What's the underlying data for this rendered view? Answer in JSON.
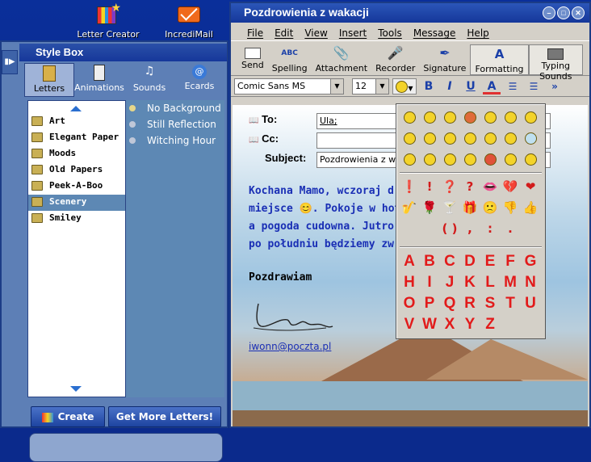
{
  "desktop": {
    "icons": [
      {
        "label": "Letter Creator"
      },
      {
        "label": "IncrediMail"
      }
    ]
  },
  "stylebox": {
    "title": "Style Box",
    "tabs": [
      "Letters",
      "Animations",
      "Sounds",
      "Ecards"
    ],
    "categories": [
      "Art",
      "Elegant Paper",
      "Moods",
      "Old Papers",
      "Peek-A-Boo",
      "Scenery",
      "Smiley"
    ],
    "selected_category": "Scenery",
    "subitems": [
      "No Background",
      "Still Reflection",
      "Witching Hour"
    ],
    "create_label": "Create",
    "more_label": "Get More Letters!"
  },
  "mail": {
    "title": "Pozdrowienia z wakacji",
    "menu": [
      "File",
      "Edit",
      "View",
      "Insert",
      "Tools",
      "Message",
      "Help"
    ],
    "toolbar": [
      "Send",
      "Spelling",
      "Attachment",
      "Recorder",
      "Signature",
      "Formatting",
      "Typing Sounds"
    ],
    "font": "Comic Sans MS",
    "size": "12",
    "to_label": "To:",
    "to_value": "Ula;",
    "cc_label": "Cc:",
    "cc_value": "",
    "subject_label": "Subject:",
    "subject_value": "Pozdrowienia z wakacji",
    "body_lines": [
      "Kochana Mamo, wczoraj d",
      "miejsce 😊. Pokoje w hote",
      "a pogoda cudowna. Jutro",
      "po południu będziemy zw"
    ],
    "greeting": "Pozdrawiam",
    "email": "iwonn@poczta.pl"
  },
  "emoticons": {
    "symbols_row1": [
      "❗",
      "!",
      "❓",
      "?",
      "👄",
      "💔",
      "❤"
    ],
    "symbols_row2": [
      "🎷",
      "🌹",
      "🍸",
      "🎁",
      "🙁",
      "👎",
      "👍"
    ],
    "punct": [
      "",
      "",
      "( )",
      ",",
      ":",
      "."
    ],
    "letters": [
      "A",
      "B",
      "C",
      "D",
      "E",
      "F",
      "G",
      "H",
      "I",
      "J",
      "K",
      "L",
      "M",
      "N",
      "O",
      "P",
      "Q",
      "R",
      "S",
      "T",
      "U",
      "V",
      "W",
      "X",
      "Y",
      "Z"
    ]
  }
}
